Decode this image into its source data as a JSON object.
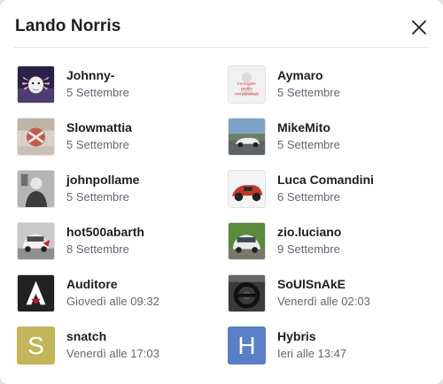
{
  "dialog": {
    "title": "Lando Norris"
  },
  "avatar_placeholder_text": [
    "Immagine",
    "profilo",
    "non personale"
  ],
  "people": [
    {
      "name": "Johnny-",
      "time": "5 Settembre",
      "avatar": "axolotl-photo"
    },
    {
      "name": "Aymaro",
      "time": "5 Settembre",
      "avatar": "placeholder-image"
    },
    {
      "name": "Slowmattia",
      "time": "5 Settembre",
      "avatar": "emblem-photo"
    },
    {
      "name": "MikeMito",
      "time": "5 Settembre",
      "avatar": "car-road-photo"
    },
    {
      "name": "johnpollame",
      "time": "5 Settembre",
      "avatar": "person-photo"
    },
    {
      "name": "Luca Comandini",
      "time": "6 Settembre",
      "avatar": "red-car-photo"
    },
    {
      "name": "hot500abarth",
      "time": "8 Settembre",
      "avatar": "white-car-photo"
    },
    {
      "name": "zio.luciano",
      "time": "9 Settembre",
      "avatar": "hatchback-photo"
    },
    {
      "name": "Auditore",
      "time": "Giovedì alle 09:32",
      "avatar": "assassin-logo"
    },
    {
      "name": "SoUlSnAkE",
      "time": "Venerdì alle 02:03",
      "avatar": "steering-wheel-photo"
    },
    {
      "name": "snatch",
      "time": "Venerdì alle 17:03",
      "avatar": "letter",
      "letter": "S",
      "color": "#c5b55a"
    },
    {
      "name": "Hybris",
      "time": "Ieri alle 13:47",
      "avatar": "letter",
      "letter": "H",
      "color": "#5b7fc7"
    }
  ]
}
